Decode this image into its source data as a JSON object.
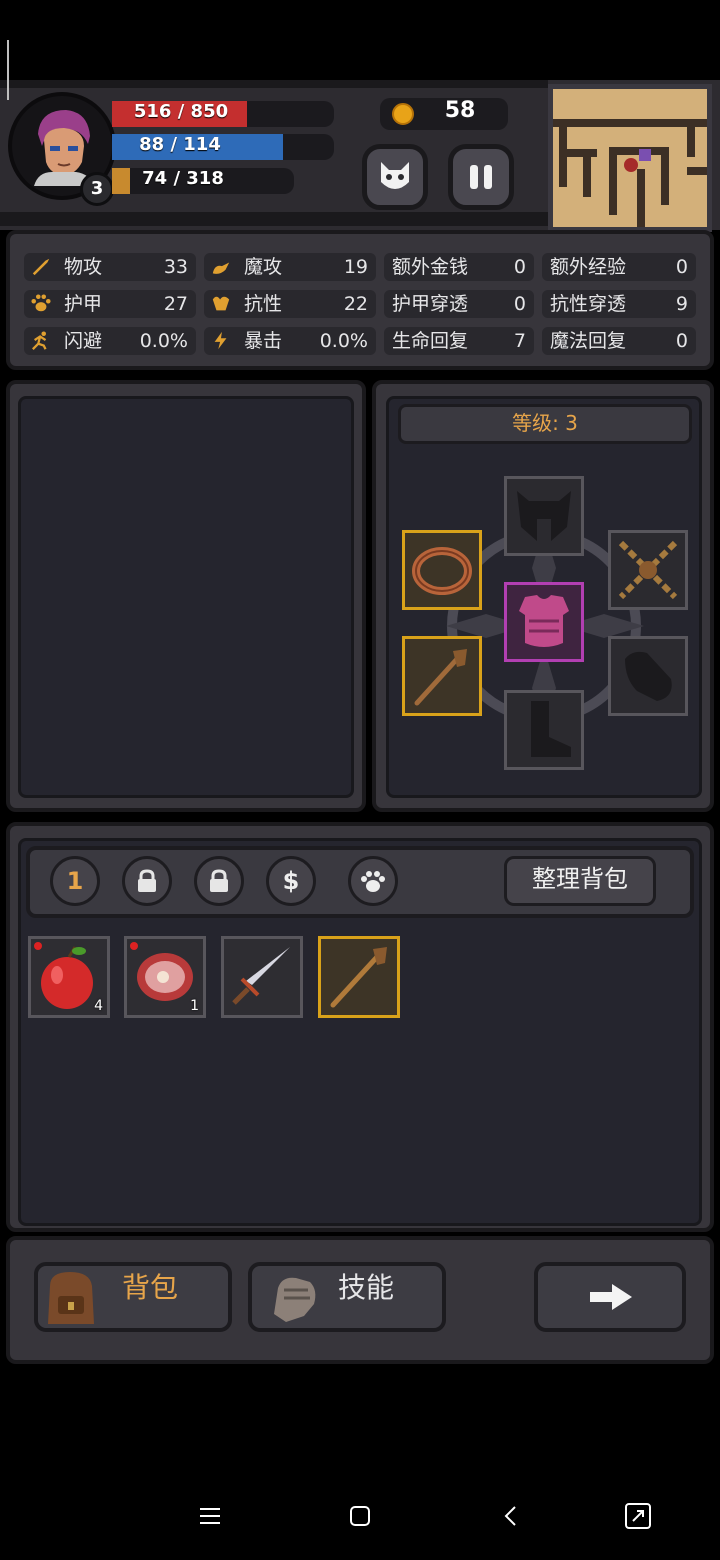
{
  "player": {
    "level": "3",
    "hp_text": "516 / 850",
    "hp_fraction": 0.607,
    "mp_text": "88 / 114",
    "mp_fraction": 0.772,
    "xp_text": "74 / 318",
    "xp_fraction": 0.233,
    "gold": "58"
  },
  "colors": {
    "hp": "#c42f2f",
    "mp": "#2e6bb8",
    "xp": "#c88a2e",
    "level_text": "#e7a54a",
    "gold_border": "#d9a21a",
    "purple_border": "#b23fb2"
  },
  "hud_buttons": [
    {
      "name": "pet-face-icon"
    },
    {
      "name": "pause-icon"
    }
  ],
  "stats": [
    {
      "icon": "sword-icon",
      "label": "物攻",
      "value": "33"
    },
    {
      "icon": "magic-hand-icon",
      "label": "魔攻",
      "value": "19"
    },
    {
      "label": "额外金钱",
      "value": "0"
    },
    {
      "label": "额外经验",
      "value": "0"
    },
    {
      "icon": "paw-icon",
      "label": "护甲",
      "value": "27"
    },
    {
      "icon": "muscle-icon",
      "label": "抗性",
      "value": "22"
    },
    {
      "label": "护甲穿透",
      "value": "0"
    },
    {
      "label": "抗性穿透",
      "value": "9"
    },
    {
      "icon": "running-icon",
      "label": "闪避",
      "value": "0.0%"
    },
    {
      "icon": "lightning-icon",
      "label": "暴击",
      "value": "0.0%"
    },
    {
      "label": "生命回复",
      "value": "7"
    },
    {
      "label": "魔法回复",
      "value": "0"
    }
  ],
  "equipment": {
    "level_label": "等级: 3",
    "slots": [
      {
        "slot": "helmet",
        "icon": "helmet-icon",
        "state": "empty"
      },
      {
        "slot": "ring",
        "icon": "ring-icon",
        "state": "equipped-gold"
      },
      {
        "slot": "necklace",
        "icon": "chain-icon",
        "state": "empty"
      },
      {
        "slot": "armor",
        "icon": "armor-icon",
        "state": "equipped-purple"
      },
      {
        "slot": "weapon",
        "icon": "staff-icon",
        "state": "equipped-gold"
      },
      {
        "slot": "gloves",
        "icon": "glove-icon",
        "state": "empty"
      },
      {
        "slot": "boots",
        "icon": "boot-icon",
        "state": "empty"
      }
    ]
  },
  "inventory": {
    "tabs": [
      {
        "label": "1",
        "icon": ""
      },
      {
        "label": "",
        "icon": "lock-icon"
      },
      {
        "label": "",
        "icon": "lock-icon"
      },
      {
        "label": "$",
        "icon": ""
      },
      {
        "label": "",
        "icon": "paw-icon"
      }
    ],
    "sort_label": "整理背包",
    "items": [
      {
        "icon": "apple-icon",
        "count": "4",
        "new": true
      },
      {
        "icon": "meat-icon",
        "count": "1",
        "new": true
      },
      {
        "icon": "dagger-icon",
        "count": "",
        "new": false
      },
      {
        "icon": "staff-icon",
        "count": "",
        "new": false,
        "highlight": "gold"
      }
    ]
  },
  "nav": {
    "bag_label": "背包",
    "skills_label": "技能",
    "next_icon": "arrow-right-icon"
  },
  "system_nav": [
    "menu-icon",
    "home-icon",
    "back-icon",
    "screenshot-icon"
  ]
}
